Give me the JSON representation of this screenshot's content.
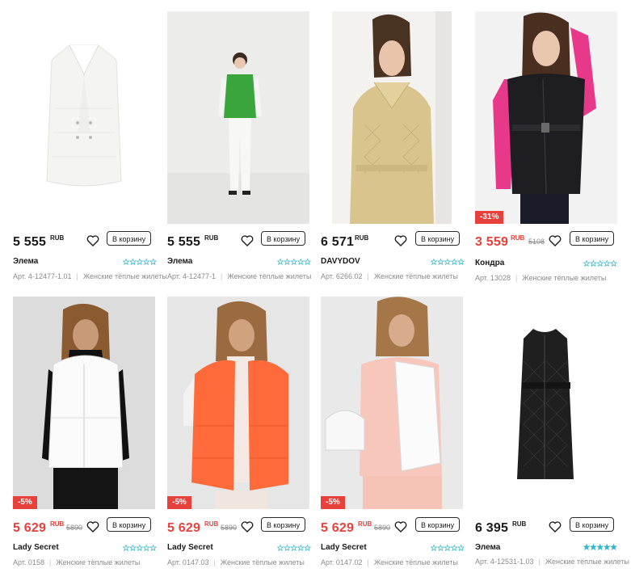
{
  "currency": "RUB",
  "add_to_cart_label": "В корзину",
  "category_label": "Женские тёплые жилеты",
  "products": [
    {
      "price": "5 555",
      "old_price": "",
      "discount": "",
      "brand": "Элема",
      "article": "Арт. 4-12477-1.01",
      "rating_filled": 0
    },
    {
      "price": "5 555",
      "old_price": "",
      "discount": "",
      "brand": "Элема",
      "article": "Арт. 4-12477-1",
      "rating_filled": 0
    },
    {
      "price": "6 571",
      "old_price": "",
      "discount": "",
      "brand": "DAVYDOV",
      "article": "Арт. 6266.02",
      "rating_filled": 0
    },
    {
      "price": "3 559",
      "old_price": "5108",
      "discount": "-31%",
      "brand": "Кондра",
      "article": "Арт. 13028",
      "rating_filled": 0
    },
    {
      "price": "5 629",
      "old_price": "5890",
      "discount": "-5%",
      "brand": "Lady Secret",
      "article": "Арт. 0158",
      "rating_filled": 0
    },
    {
      "price": "5 629",
      "old_price": "5890",
      "discount": "-5%",
      "brand": "Lady Secret",
      "article": "Арт. 0147.03",
      "rating_filled": 0
    },
    {
      "price": "5 629",
      "old_price": "5890",
      "discount": "-5%",
      "brand": "Lady Secret",
      "article": "Арт. 0147.02",
      "rating_filled": 0
    },
    {
      "price": "6 395",
      "old_price": "",
      "discount": "",
      "brand": "Элема",
      "article": "Арт. 4-12531-1.03",
      "rating_filled": 5
    }
  ],
  "colors": {
    "sale": "#e8413c",
    "star": "#3bb6c9",
    "text": "#1a1a1a",
    "muted": "#8a8a8a"
  }
}
